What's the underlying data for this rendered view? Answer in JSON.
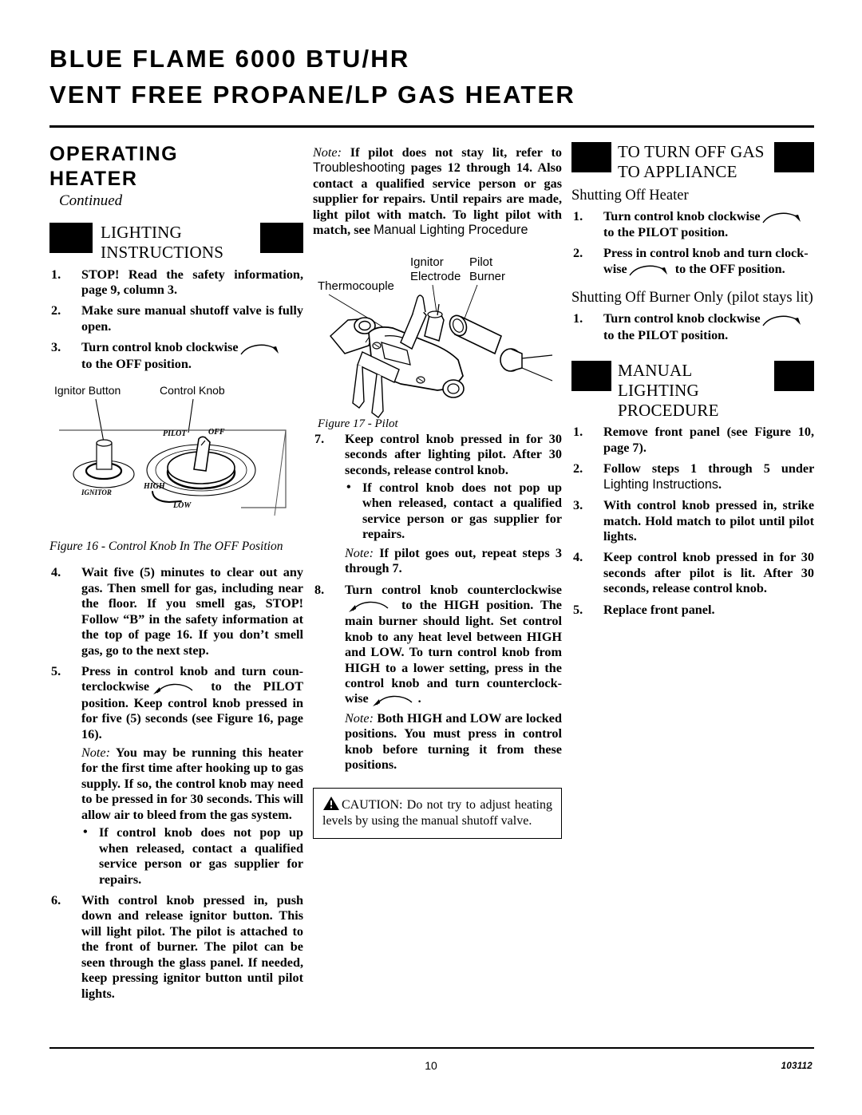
{
  "header": {
    "line1": "BLUE FLAME 6000 BTU/HR",
    "line2": "VENT FREE PROPANE/LP GAS HEATER"
  },
  "col1": {
    "section_heading": "OPERATING HEATER",
    "continued": "Continued",
    "lighting_title": "LIGHTING INSTRUCTIONS",
    "steps": [
      {
        "num": "1.",
        "text": "STOP! Read the safety information, page 9, column 3."
      },
      {
        "num": "2.",
        "text": "Make sure manual shutoff valve is fully open."
      },
      {
        "num": "3.",
        "pre": "Turn control knob clockwise",
        "post": "to the OFF position."
      }
    ],
    "figure16": {
      "label_ignitor_button": "Ignitor Button",
      "label_control_knob": "Control Knob",
      "dial_pilot": "PILOT",
      "dial_off": "OFF",
      "dial_high": "HIGH",
      "dial_low": "LOW",
      "dial_ignitor": "IGNITOR",
      "caption": "Figure 16 - Control Knob In The OFF Position"
    },
    "steps2": [
      {
        "num": "4.",
        "text": "Wait five (5) minutes to clear out any gas. Then smell for gas, including near the floor. If you smell gas, STOP! Follow “B” in the safety information at the top of page 16. If you don’t smell gas, go to the next step."
      }
    ],
    "step5": {
      "num": "5.",
      "pre": "Press in control knob and turn coun-terclockwise",
      "post": "to the PILOT position. Keep control knob pressed in for five (5) seconds (see Figure 16, page 16).",
      "note_label": "Note:",
      "note_text": "You may be running this heater for the first time after hooking up to gas supply. If so, the control knob may need to be pressed in for 30 seconds. This will allow air to bleed from the gas system.",
      "bullet": "If control knob does not pop up when released, contact a qualified service person or gas supplier for repairs."
    },
    "step6": {
      "num": "6.",
      "text": "With control knob pressed in, push down and release ignitor button. This will light pilot. The pilot is attached to the front of burner. The pilot can be seen through the glass panel. If needed, keep pressing ignitor button until pilot lights."
    }
  },
  "col2": {
    "note_top": {
      "label": "Note:",
      "part1": "If pilot does not stay lit, refer to",
      "ref1": "Troubleshooting",
      "part2": "pages 12 through 14. Also contact a qualified service person or gas supplier for repairs. Until repairs are made, light pilot with match. To light pilot with match, see",
      "ref2": "Manual Lighting Procedure"
    },
    "figure17": {
      "label_thermocouple": "Thermocouple",
      "label_ignitor_electrode": "Ignitor Electrode",
      "label_pilot_burner": "Pilot Burner",
      "caption": "Figure 17 - Pilot"
    },
    "step7": {
      "num": "7.",
      "text": "Keep control knob pressed in for 30 seconds after lighting pilot. After 30 seconds, release control knob.",
      "bullet": "If control knob does not pop up when released, contact a qualified service person or gas supplier for repairs.",
      "note_label": "Note:",
      "note_text": "If pilot goes out, repeat steps 3 through 7."
    },
    "step8": {
      "num": "8.",
      "pre": "Turn control knob counterclockwise",
      "mid": "to the HIGH position. The main burner should light. Set control knob to any heat level between HIGH and LOW. To turn control knob from HIGH to a lower setting, press in the control knob and turn counterclock-wise",
      "post": ".",
      "note_label": "Note:",
      "note_text": "Both HIGH and LOW are locked positions. You must press in control knob before turning it from these positions."
    },
    "caution": {
      "word": "CAUTION:",
      "text": "Do not try to adjust heating levels by using the manual shutoff valve."
    }
  },
  "col3": {
    "turnoff_title": "TO TURN OFF GAS TO APPLIANCE",
    "sub1": "Shutting Off Heater",
    "sub1_steps": [
      {
        "num": "1.",
        "pre": "Turn control knob clockwise",
        "post": "to the PILOT position."
      },
      {
        "num": "2.",
        "pre": "Press in control knob and turn clock-wise",
        "post": "to the OFF position."
      }
    ],
    "sub2": "Shutting Off Burner Only (pilot stays lit)",
    "sub2_steps": [
      {
        "num": "1.",
        "pre": "Turn control knob clockwise",
        "post": "to the PILOT position."
      }
    ],
    "manual_title": "MANUAL LIGHTING PROCEDURE",
    "manual_steps": [
      {
        "num": "1.",
        "text": "Remove front panel (see Figure 10, page 7)."
      },
      {
        "num": "2.",
        "pre": "Follow steps 1 through 5 under",
        "ref": "Lighting Instructions",
        "post": "."
      },
      {
        "num": "3.",
        "text": "With control knob pressed in, strike match. Hold match to pilot until pilot lights."
      },
      {
        "num": "4.",
        "text": "Keep control knob pressed in for 30 seconds after pilot is lit. After 30 seconds, release control knob."
      },
      {
        "num": "5.",
        "text": "Replace front panel."
      }
    ]
  },
  "footer": {
    "page_number": "10",
    "doc_number": "103112"
  }
}
